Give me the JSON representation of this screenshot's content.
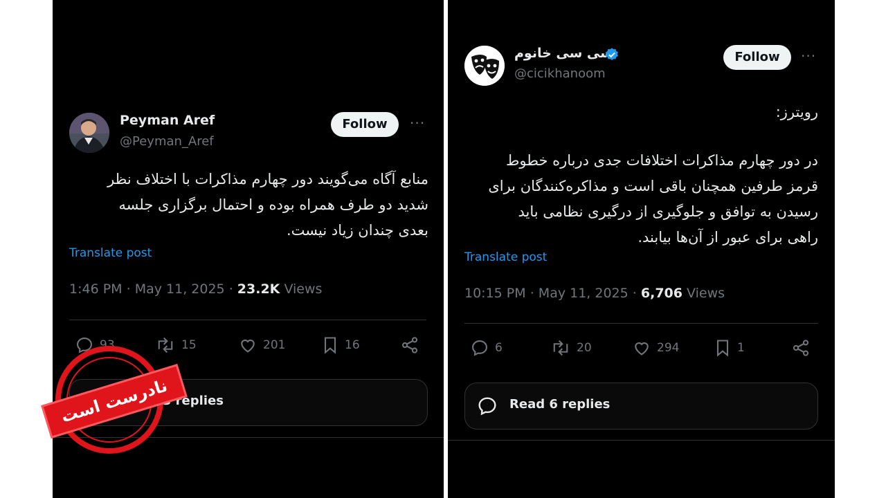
{
  "left_post": {
    "author_name": "Peyman Aref",
    "author_handle": "@Peyman_Aref",
    "follow_label": "Follow",
    "body_lines": [
      "منابع آگاه می‌گویند دور چهارم مذاکرات با اختلاف نظر",
      "شدید دو طرف همراه بوده و احتمال برگزاری جلسه",
      "بعدی چندان زیاد نیست."
    ],
    "translate_label": "Translate post",
    "time": "1:46 PM",
    "date": "May 11, 2025",
    "views_count": "23.2K",
    "views_label": "Views",
    "replies_count": "93",
    "reposts_count": "15",
    "likes_count": "201",
    "bookmarks_count": "16",
    "read_replies_label": "Read 93 replies"
  },
  "right_post": {
    "author_name": "سی سی خانوم",
    "author_handle": "@cicikhanoom",
    "verified": true,
    "follow_label": "Follow",
    "body_heading": "رویترز:",
    "body_lines": [
      "در دور چهارم مذاکرات اختلافات جدی درباره خطوط",
      "قرمز طرفین همچنان باقی است و مذاکره‌کنندگان برای",
      "رسیدن به توافق و جلوگیری از درگیری نظامی باید",
      "راهی برای عبور از آن‌ها بیابند."
    ],
    "translate_label": "Translate post",
    "time": "10:15 PM",
    "date": "May 11, 2025",
    "views_count": "6,706",
    "views_label": "Views",
    "replies_count": "6",
    "reposts_count": "20",
    "likes_count": "294",
    "bookmarks_count": "1",
    "read_replies_label": "Read 6 replies"
  },
  "stamp": {
    "label": "نادرست است",
    "color": "#e0141b"
  },
  "colors": {
    "background": "#000000",
    "text": "#e7e9ea",
    "muted": "#71767b",
    "link": "#1d9bf0",
    "verified": "#1d9bf0"
  }
}
